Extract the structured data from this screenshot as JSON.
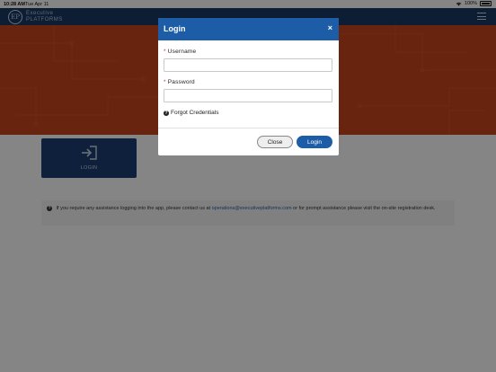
{
  "status_bar": {
    "time": "10:28 AM",
    "date": "Tue Apr 11",
    "battery": "100%"
  },
  "navbar": {
    "logo_line1": "Executive",
    "logo_line2": "PLATFORMS",
    "logo_mark": "EP",
    "menu_icon": "hamburger-menu-icon"
  },
  "tiles": {
    "login_label": "LOGIN",
    "login_icon": "sign-in-arrow-icon"
  },
  "notice": {
    "text_before": "If you require any assistance logging into the app, please contact us at",
    "email": "operations@executiveplatforms.com",
    "text_after": "or for prompt assistance please visit the on-site registration desk."
  },
  "modal": {
    "title": "Login",
    "close_glyph": "×",
    "username_label": "Username",
    "username_value": "",
    "password_label": "Password",
    "password_value": "",
    "required_mark": "*",
    "forgot_label": "Forgot Credentials",
    "close_button": "Close",
    "login_button": "Login"
  },
  "colors": {
    "navbar": "#1a3862",
    "hero": "#c9461e",
    "modal_header": "#1d5da8",
    "tile": "#1d3f73"
  }
}
